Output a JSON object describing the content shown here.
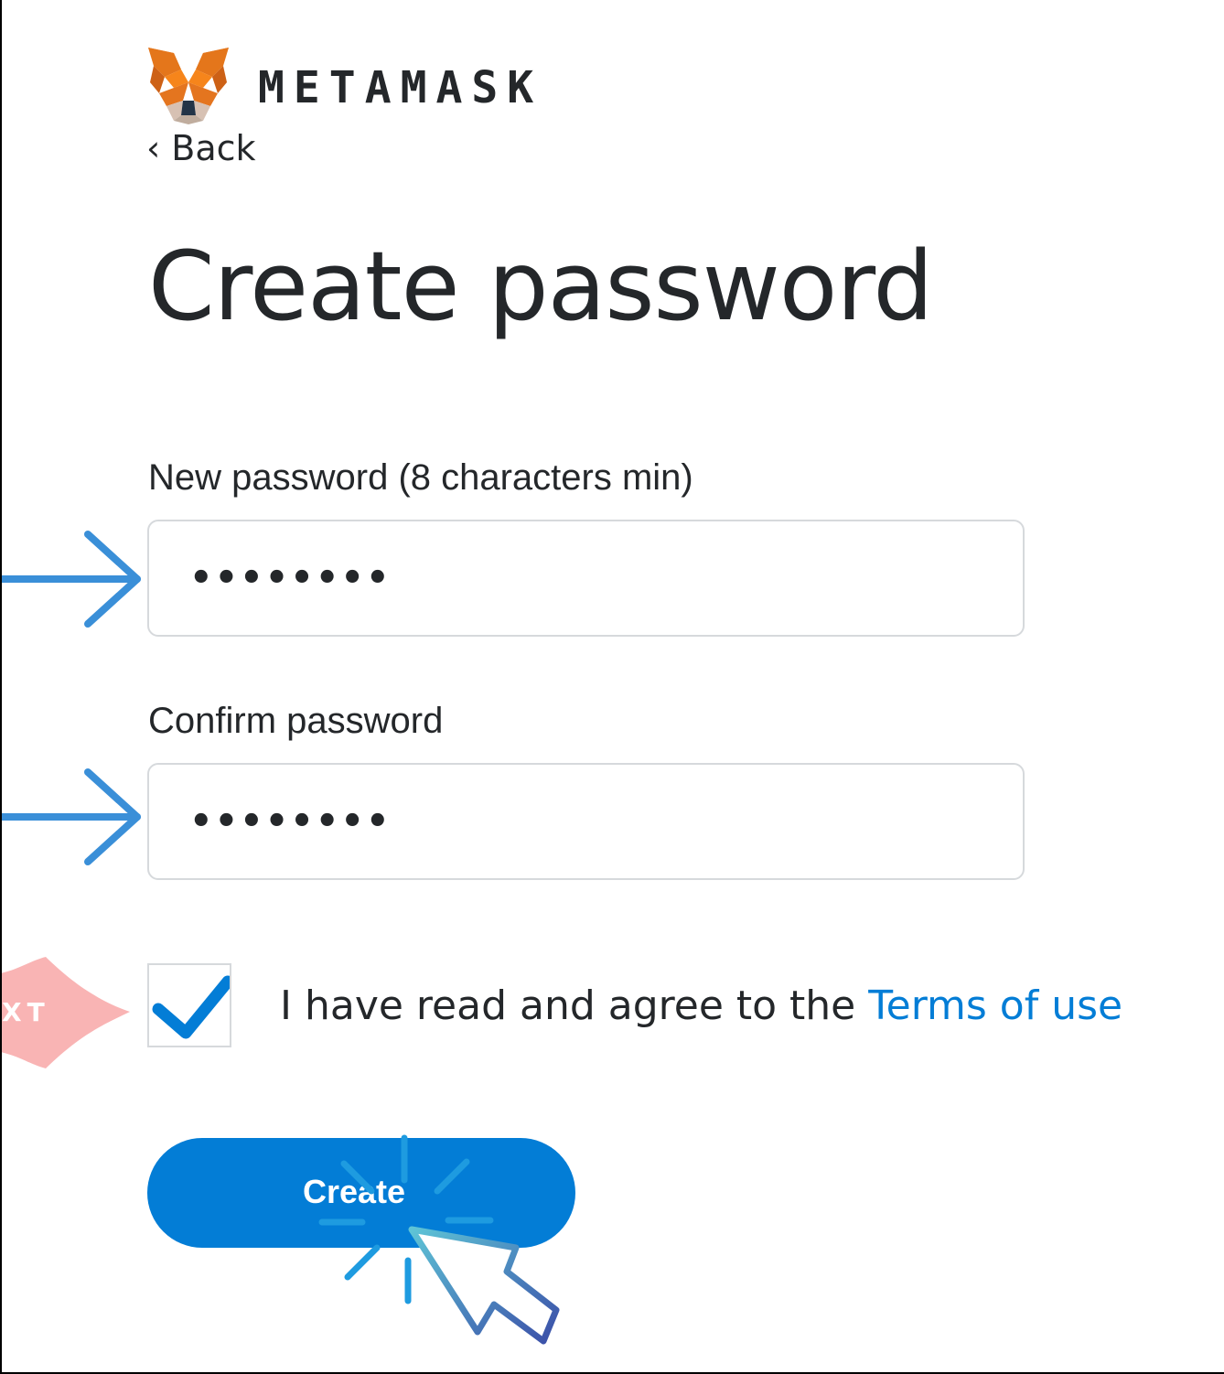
{
  "header": {
    "brand_name": "METAMASK",
    "logo_icon": "metamask-fox-icon",
    "back_label": "‹ Back"
  },
  "page": {
    "title": "Create password"
  },
  "form": {
    "new_password": {
      "label": "New password (8 characters min)",
      "value": "••••••••"
    },
    "confirm_password": {
      "label": "Confirm password",
      "value": "••••••••"
    },
    "terms": {
      "checked": true,
      "text": "I have read and agree to the ",
      "link_label": "Terms of use"
    },
    "create_label": "Create"
  },
  "annotations": {
    "arrow_icon": "right-arrow-icon",
    "next_badge_text": "XT",
    "cursor_icon": "pointer-cursor-icon"
  },
  "colors": {
    "accent": "#037dd6",
    "arrow": "#3a8fd8",
    "badge": "#f9b4b4",
    "text": "#24272a",
    "border": "#d6d9dc",
    "fox_orange": "#f6851b"
  }
}
